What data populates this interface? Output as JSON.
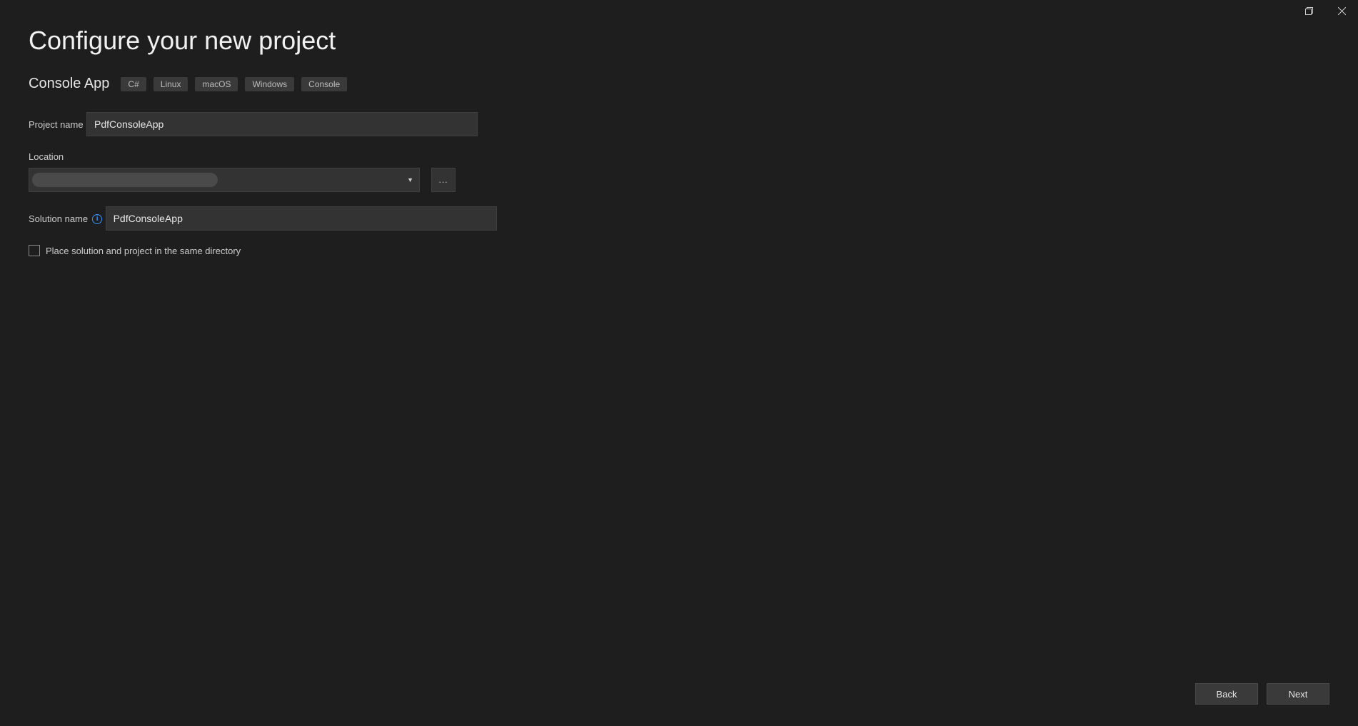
{
  "window": {
    "maximize_icon": "❐",
    "close_icon": "✕"
  },
  "header": {
    "title": "Configure your new project",
    "template_name": "Console App",
    "tags": [
      "C#",
      "Linux",
      "macOS",
      "Windows",
      "Console"
    ]
  },
  "form": {
    "project_name_label": "Project name",
    "project_name_value": "PdfConsoleApp",
    "location_label": "Location",
    "location_value": "",
    "browse_label": "...",
    "solution_name_label": "Solution name",
    "solution_name_value": "PdfConsoleApp",
    "same_dir_label": "Place solution and project in the same directory",
    "same_dir_checked": false
  },
  "footer": {
    "back_label": "Back",
    "next_label": "Next"
  }
}
